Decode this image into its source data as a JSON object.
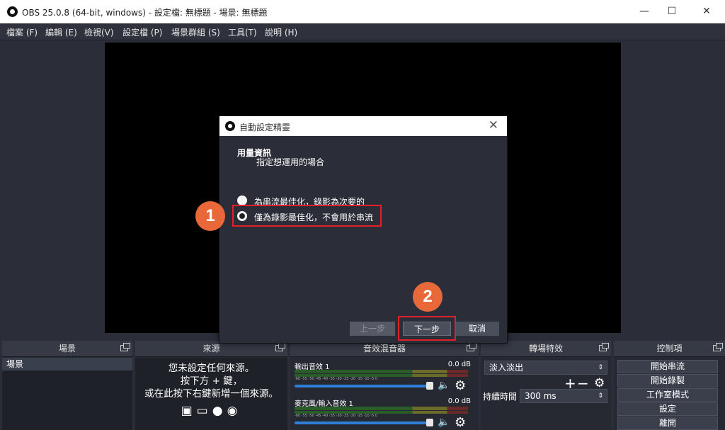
{
  "window": {
    "title": "OBS 25.0.8 (64-bit, windows) - 設定檔: 無標題 - 場景: 無標題"
  },
  "menu": [
    "檔案 (F)",
    "編輯 (E)",
    "檢視(V)",
    "設定檔 (P)",
    "場景群組 (S)",
    "工具(T)",
    "說明 (H)"
  ],
  "panels": {
    "scenes": {
      "title": "場景",
      "items": [
        "場景"
      ]
    },
    "sources": {
      "title": "來源",
      "empty_line1": "您未設定任何來源。",
      "empty_line2": "按下方 + 鍵，",
      "empty_line3": "或在此按下右鍵新增一個來源。"
    },
    "mixer": {
      "title": "音效混音器",
      "tracks": [
        {
          "name": "輸出音效 1",
          "db": "0.0 dB"
        },
        {
          "name": "麥克風/輸入音效 1",
          "db": "0.0 dB"
        }
      ],
      "ticks": "-60 -55 -50 -45 -40 -35 -30 -25 -20 -15 -10 -5 0"
    },
    "transitions": {
      "title": "轉場特效",
      "selected": "淡入淡出",
      "duration_label": "持續時間",
      "duration_value": "300 ms"
    },
    "controls": {
      "title": "控制項",
      "buttons": [
        "開始串流",
        "開始錄製",
        "工作室模式",
        "設定",
        "離開"
      ]
    }
  },
  "dialog": {
    "title": "自動設定精靈",
    "heading": "用量資訊",
    "subheading": "指定想運用的場合",
    "options": [
      {
        "label": "為串流最佳化，錄影為次要的",
        "selected": false
      },
      {
        "label": "僅為錄影最佳化，不會用於串流",
        "selected": true
      }
    ],
    "back": "上一步",
    "next": "下一步",
    "cancel": "取消"
  },
  "annotations": {
    "badge1": "1",
    "badge2": "2",
    "highlight_color": "#e0202a",
    "badge_color": "#e8683a"
  }
}
